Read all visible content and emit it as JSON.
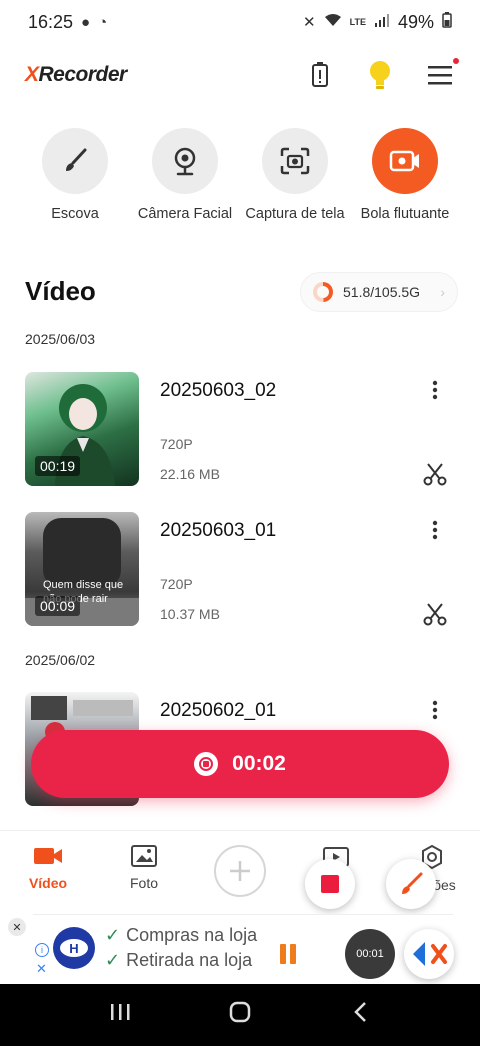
{
  "status_bar": {
    "time": "16:25",
    "battery": "49%",
    "network_label": "LTE"
  },
  "header": {
    "logo_prefix": "X",
    "logo_rest": "Recorder"
  },
  "tools": [
    {
      "label": "Escova",
      "icon": "brush-icon"
    },
    {
      "label": "Câmera Facial",
      "icon": "webcam-icon"
    },
    {
      "label": "Captura de tela",
      "icon": "screenshot-camera-icon"
    },
    {
      "label": "Bola flutuante",
      "icon": "video-record-icon"
    }
  ],
  "video_section": {
    "title": "Vídeo",
    "storage": "51.8/105.5G",
    "storage_used_fraction": 0.49
  },
  "groups": [
    {
      "date": "2025/06/03",
      "videos": [
        {
          "title": "20250603_02",
          "resolution": "720P",
          "size": "22.16 MB",
          "duration": "00:19"
        },
        {
          "title": "20250603_01",
          "resolution": "720P",
          "size": "10.37 MB",
          "duration": "00:09",
          "caption": "Quem disse que não pode rair"
        }
      ]
    },
    {
      "date": "2025/06/02",
      "videos": [
        {
          "title": "20250602_01",
          "resolution": "",
          "size": "",
          "duration": ""
        }
      ]
    }
  ],
  "recording": {
    "elapsed": "00:02",
    "bubble_time": "00:01"
  },
  "bottom_nav": {
    "video": "Vídeo",
    "photo": "Foto",
    "settings": "ções"
  },
  "ad": {
    "line1": "Compras na loja",
    "line2": "Retirada na loja",
    "logo_letter": "H"
  },
  "colors": {
    "accent": "#f0511c",
    "record": "#ea2449"
  }
}
